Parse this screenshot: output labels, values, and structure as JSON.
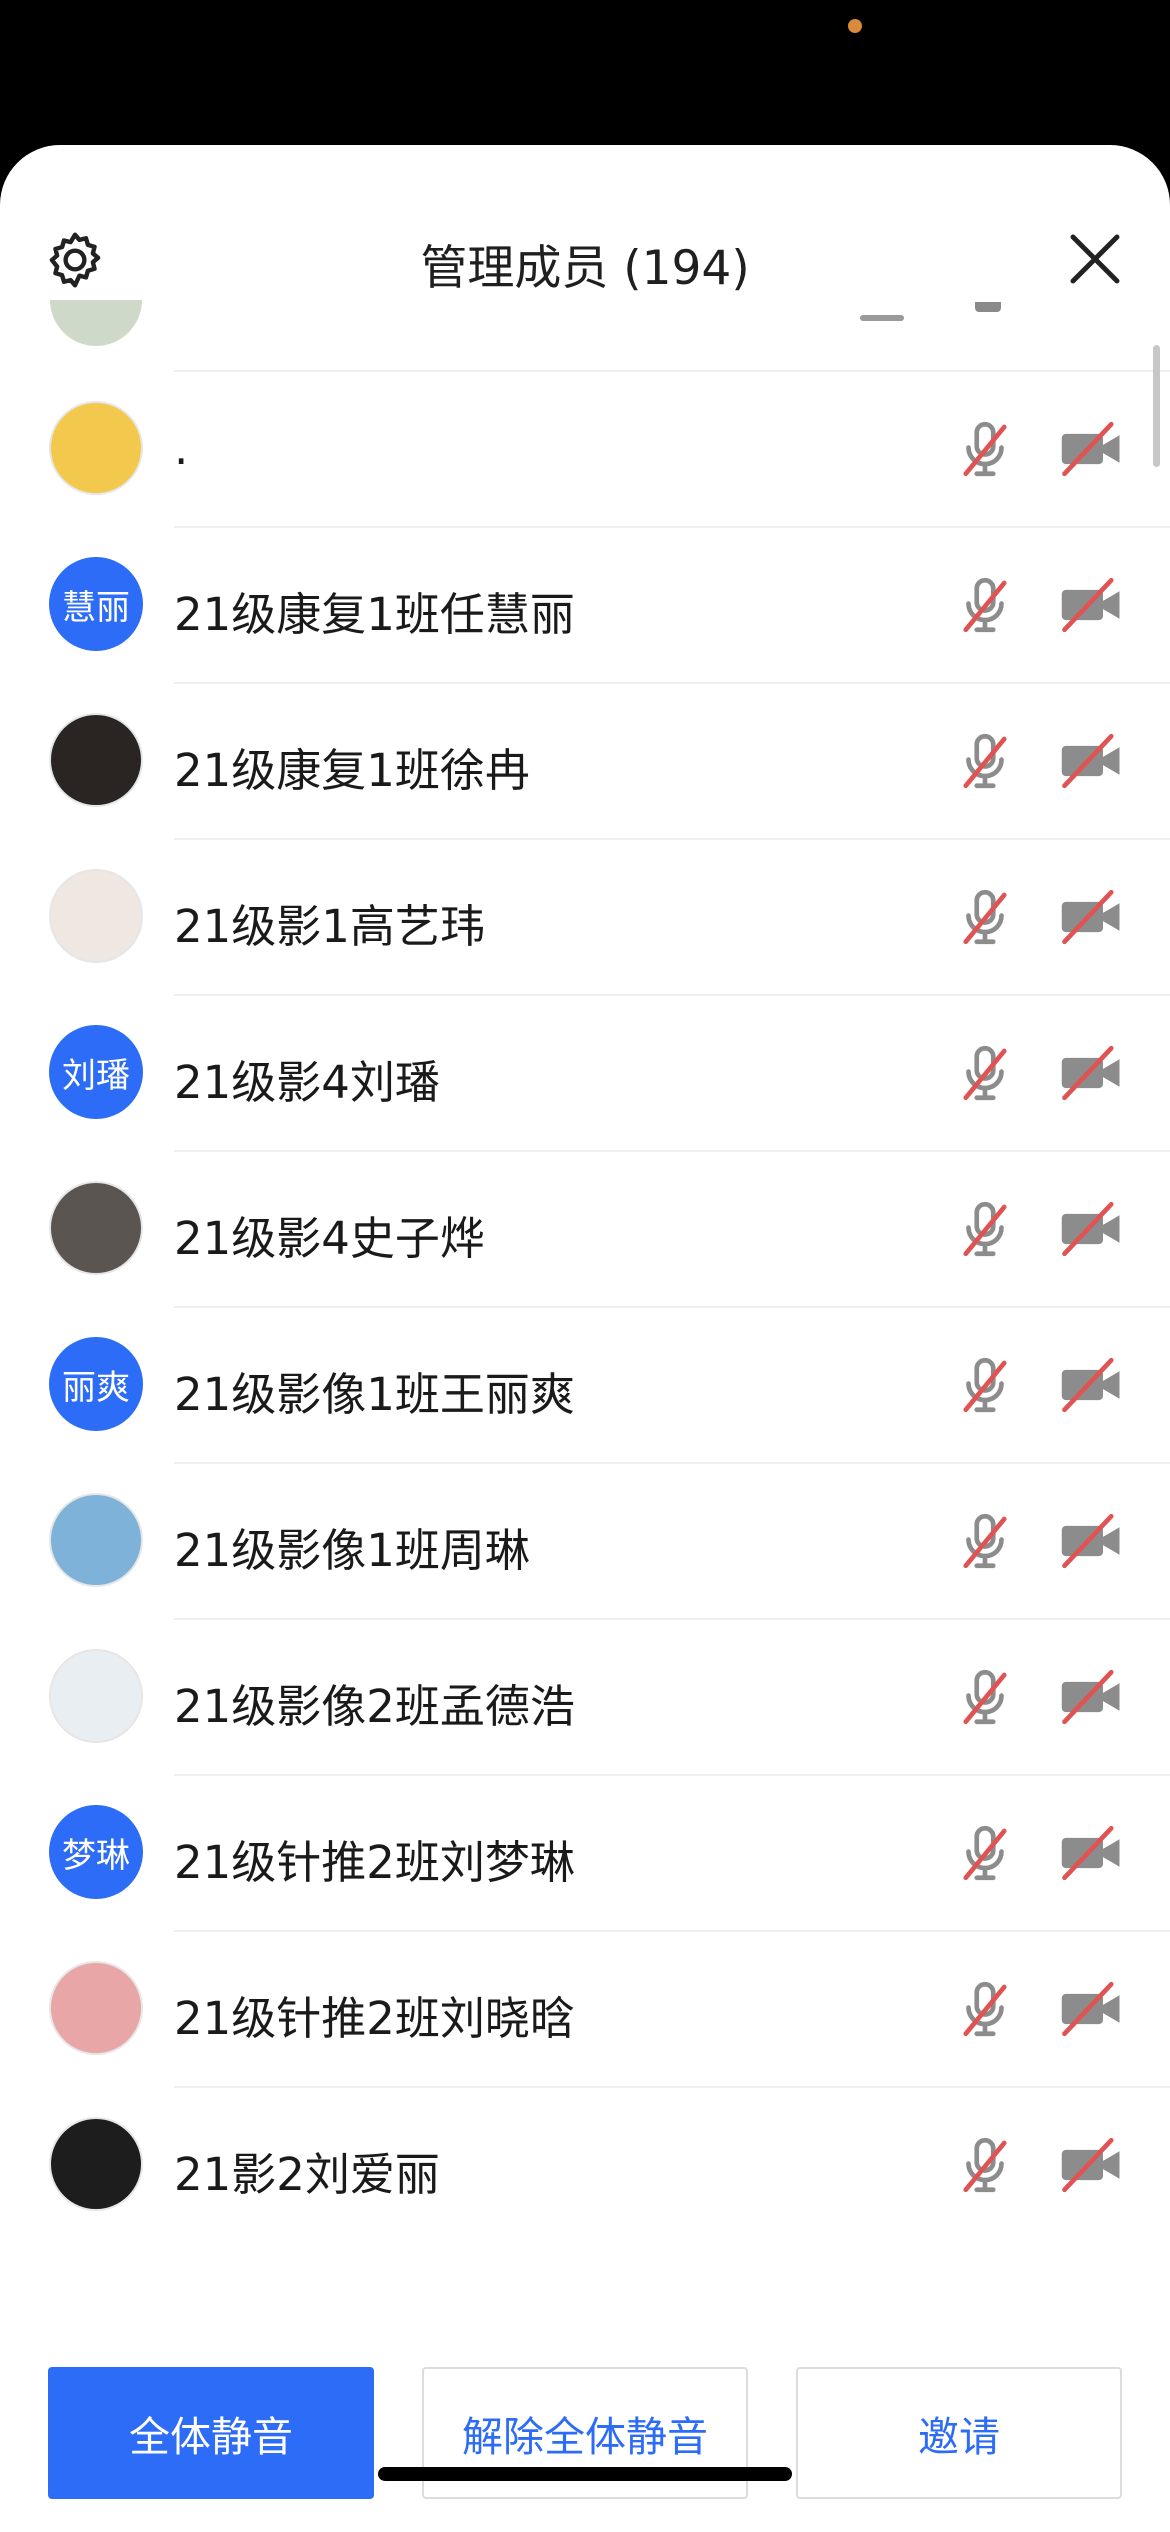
{
  "header": {
    "title": "管理成员 (194)"
  },
  "members": [
    {
      "name": ".",
      "avatar_text": "",
      "avatar_color": "#f2c94c",
      "avatar_kind": "photo"
    },
    {
      "name": "21级康复1班任慧丽",
      "avatar_text": "慧丽",
      "avatar_color": "#2d6cf6",
      "avatar_kind": "initials"
    },
    {
      "name": "21级康复1班徐冉",
      "avatar_text": "",
      "avatar_color": "#2a2422",
      "avatar_kind": "photo"
    },
    {
      "name": "21级影1高艺玮",
      "avatar_text": "",
      "avatar_color": "#efe7e1",
      "avatar_kind": "photo"
    },
    {
      "name": "21级影4刘璠",
      "avatar_text": "刘璠",
      "avatar_color": "#2d6cf6",
      "avatar_kind": "initials"
    },
    {
      "name": "21级影4史子烨",
      "avatar_text": "",
      "avatar_color": "#5b5552",
      "avatar_kind": "photo"
    },
    {
      "name": "21级影像1班王丽爽",
      "avatar_text": "丽爽",
      "avatar_color": "#2d6cf6",
      "avatar_kind": "initials"
    },
    {
      "name": "21级影像1班周琳",
      "avatar_text": "",
      "avatar_color": "#7fb2d9",
      "avatar_kind": "photo"
    },
    {
      "name": "21级影像2班孟德浩",
      "avatar_text": "",
      "avatar_color": "#e9eef3",
      "avatar_kind": "photo"
    },
    {
      "name": "21级针推2班刘梦琳",
      "avatar_text": "梦琳",
      "avatar_color": "#2d6cf6",
      "avatar_kind": "initials"
    },
    {
      "name": "21级针推2班刘晓晗",
      "avatar_text": "",
      "avatar_color": "#e9a6a6",
      "avatar_kind": "photo"
    },
    {
      "name": "21影2刘爱丽",
      "avatar_text": "",
      "avatar_color": "#1d1d1d",
      "avatar_kind": "photo"
    }
  ],
  "footer": {
    "mute_all_label": "全体静音",
    "unmute_all_label": "解除全体静音",
    "invite_label": "邀请"
  },
  "icons": {
    "settings": "gear-icon",
    "close": "close-icon",
    "mic": "mic-muted-icon",
    "camera": "camera-off-icon"
  },
  "colors": {
    "accent": "#2d6cf6",
    "icon_gray": "#8c8c8c",
    "mute_slash": "#e05353"
  }
}
